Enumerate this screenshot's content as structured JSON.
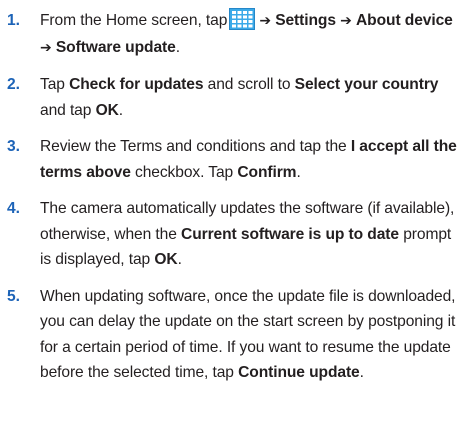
{
  "steps": [
    {
      "number": "1.",
      "t1": "From the Home screen, tap",
      "arrow": "➔",
      "settings": "Settings",
      "about_device": "About device",
      "software_update": "Software update",
      "end": ".",
      "icon": "apps-grid-icon",
      "icon_color": "#3aa9e8"
    },
    {
      "number": "2.",
      "t1": "Tap ",
      "check_for_updates": "Check for updates",
      "t2": " and scroll to ",
      "select_country": "Select your country",
      "t3": " and tap ",
      "ok": "OK",
      "end": "."
    },
    {
      "number": "3.",
      "t1": "Review the Terms and conditions and tap the ",
      "accept_all": "I accept all the terms above",
      "t2": " checkbox. Tap ",
      "confirm": "Confirm",
      "end": "."
    },
    {
      "number": "4.",
      "t1": "The camera automatically updates the software (if available), otherwise, when the ",
      "current_software": "Current software is up to date",
      "t2": " prompt is displayed, tap ",
      "ok": "OK",
      "end": "."
    },
    {
      "number": "5.",
      "t1": "When updating software, once the update file is downloaded, you can delay the update on the start screen by postponing it for a certain period of time. If you want to resume the update before the selected time, tap ",
      "continue_update": "Continue update",
      "end": "."
    }
  ],
  "colors": {
    "step_number": "#1c63b7",
    "body_text": "#231f20",
    "icon": "#3aa9e8"
  }
}
